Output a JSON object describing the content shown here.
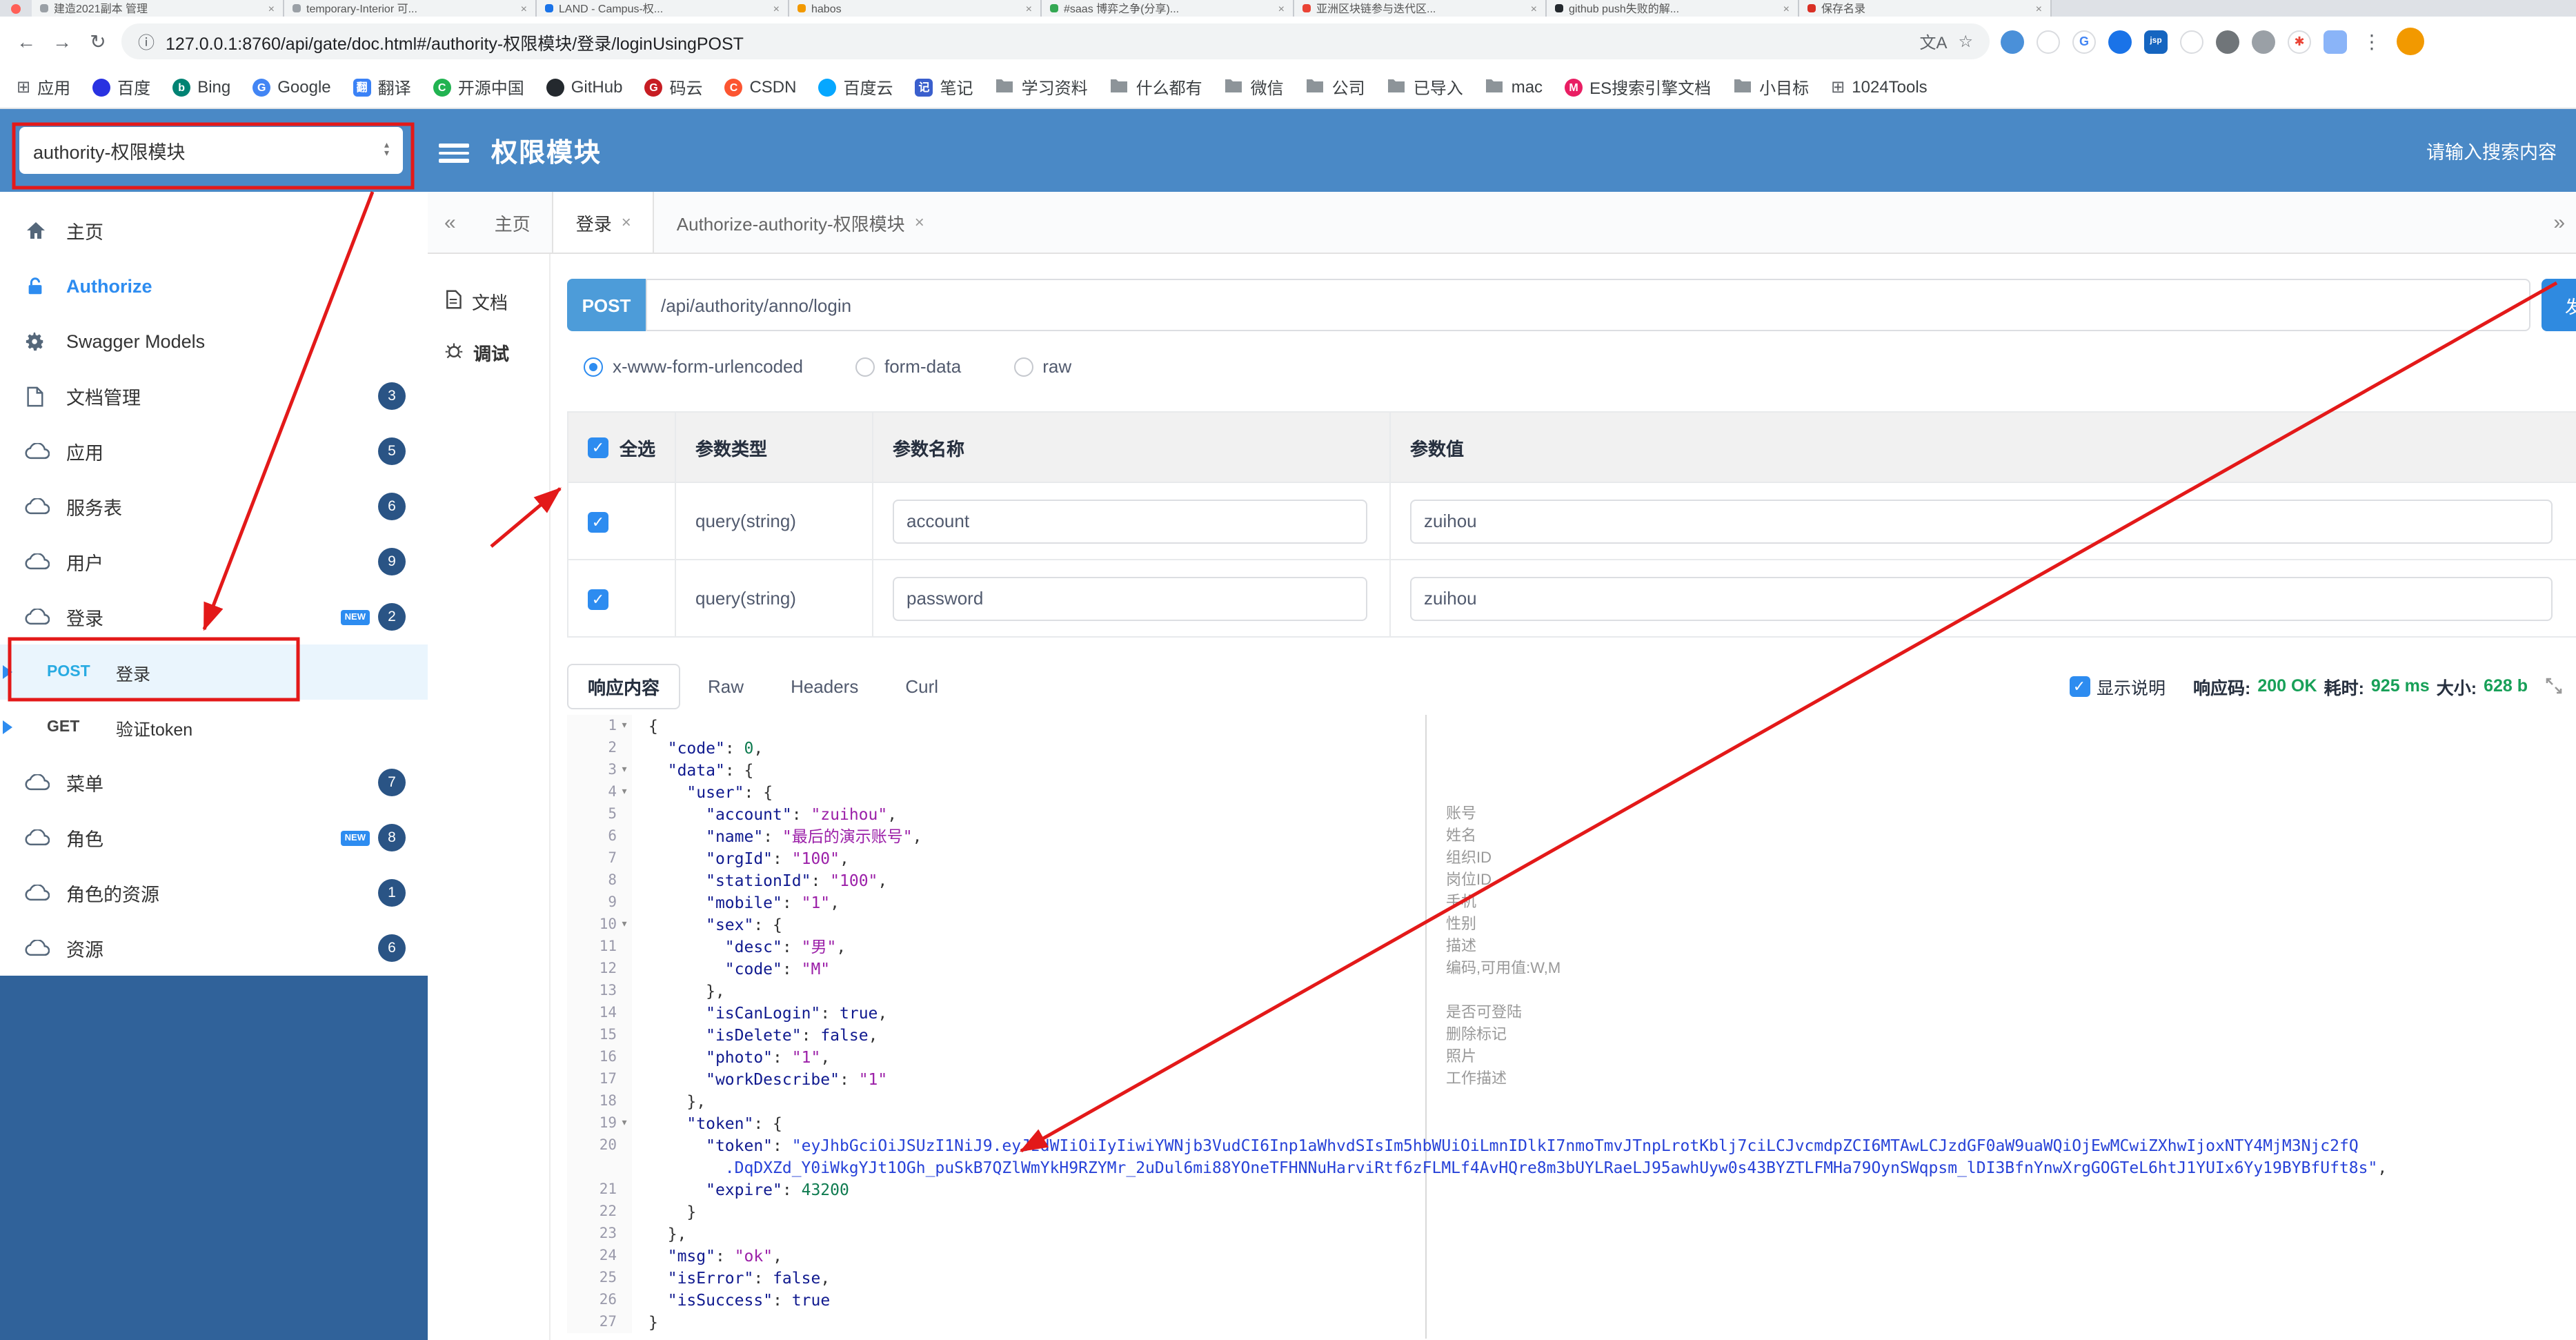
{
  "browser": {
    "window_controls": {
      "close_dot": true
    },
    "tabs": [
      {
        "title": "建造2021副本 管理",
        "color": "#9aa0a6"
      },
      {
        "title": "temporary-Interior 可...",
        "color": "#9aa0a6"
      },
      {
        "title": "LAND - Campus-权...",
        "color": "#1a73e8"
      },
      {
        "title": "habos",
        "color": "#f29900"
      },
      {
        "title": "#saas 博弈之争(分享)...",
        "color": "#34a853"
      },
      {
        "title": "亚洲区块链参与迭代区...",
        "color": "#ea4335"
      },
      {
        "title": "github push失败的解...",
        "color": "#24292e"
      },
      {
        "title": "保存名录",
        "color": "#d93025"
      }
    ],
    "url": "127.0.0.1:8760/api/gate/doc.html#/authority-权限模块/登录/loginUsingPOST",
    "ext_icons": [
      {
        "name": "extension-icon",
        "bg": "#4a90d9"
      },
      {
        "name": "extension-icon",
        "bg": "#ffffff",
        "ring": true
      },
      {
        "name": "google-icon",
        "bg": "#ffffff",
        "ch": "G",
        "fg": "#4285f4",
        "ring": true
      },
      {
        "name": "extension-icon",
        "bg": "#1a73e8"
      },
      {
        "name": "extension-icon",
        "bg": "#1565c0",
        "ch": "jsp",
        "sq": true
      },
      {
        "name": "extension-icon",
        "bg": "#ffffff",
        "ring": true
      },
      {
        "name": "shield-icon",
        "bg": "#707579"
      },
      {
        "name": "extension-icon",
        "bg": "#9aa0a6"
      },
      {
        "name": "extension-icon",
        "bg": "#ffffff",
        "ch": "✱",
        "fg": "#ea4335",
        "ring": true
      },
      {
        "name": "extension-icon",
        "bg": "#8ab4f8",
        "sq": true
      }
    ],
    "bookmarks": [
      {
        "type": "grid",
        "label": "应用"
      },
      {
        "type": "dot",
        "color": "#2932e1",
        "label": "百度"
      },
      {
        "type": "letter",
        "ch": "b",
        "color": "#008373",
        "label": "Bing"
      },
      {
        "type": "letter",
        "ch": "G",
        "color": "#4285f4",
        "label": "Google"
      },
      {
        "type": "sq",
        "ch": "翻",
        "color": "#3b82f6",
        "label": "翻译"
      },
      {
        "type": "letter",
        "ch": "C",
        "color": "#21b351",
        "label": "开源中国"
      },
      {
        "type": "dot",
        "color": "#24292e",
        "label": "GitHub"
      },
      {
        "type": "letter",
        "ch": "G",
        "color": "#c71d23",
        "label": "码云"
      },
      {
        "type": "letter",
        "ch": "C",
        "color": "#fc5531",
        "label": "CSDN"
      },
      {
        "type": "dot",
        "color": "#06a7ff",
        "label": "百度云"
      },
      {
        "type": "sq",
        "ch": "记",
        "color": "#3a5fcd",
        "label": "笔记"
      },
      {
        "type": "folder",
        "label": "学习资料"
      },
      {
        "type": "folder",
        "label": "什么都有"
      },
      {
        "type": "folder",
        "label": "微信"
      },
      {
        "type": "folder",
        "label": "公司"
      },
      {
        "type": "folder",
        "label": "已导入"
      },
      {
        "type": "folder",
        "label": "mac"
      },
      {
        "type": "letter",
        "ch": "M",
        "color": "#e91e63",
        "label": "ES搜索引擎文档"
      },
      {
        "type": "folder",
        "label": "小目标"
      },
      {
        "type": "grid",
        "label": "1024Tools"
      }
    ]
  },
  "header": {
    "module_select": "authority-权限模块",
    "title": "权限模块",
    "search_placeholder": "请输入搜索内容"
  },
  "sidebar": {
    "items": [
      {
        "icon": "home-icon",
        "label": "主页"
      },
      {
        "icon": "unlock-icon",
        "label": "Authorize",
        "highlight": true
      },
      {
        "icon": "gear-icon",
        "label": "Swagger Models"
      },
      {
        "icon": "doc-icon",
        "label": "文档管理",
        "badge": "3"
      },
      {
        "icon": "cloud-icon",
        "label": "应用",
        "badge": "5"
      },
      {
        "icon": "cloud-icon",
        "label": "服务表",
        "badge": "6"
      },
      {
        "icon": "cloud-icon",
        "label": "用户",
        "badge": "9"
      },
      {
        "icon": "cloud-icon",
        "label": "登录",
        "badge": "2",
        "new": true,
        "children": [
          {
            "method": "POST",
            "label": "登录",
            "active": true
          },
          {
            "method": "GET",
            "label": "验证token"
          }
        ]
      },
      {
        "icon": "cloud-icon",
        "label": "菜单",
        "badge": "7"
      },
      {
        "icon": "cloud-icon",
        "label": "角色",
        "badge": "8",
        "new": true
      },
      {
        "icon": "cloud-icon",
        "label": "角色的资源",
        "badge": "1"
      },
      {
        "icon": "cloud-icon",
        "label": "资源",
        "badge": "6"
      }
    ]
  },
  "tabs_nav": {
    "collapse": "«",
    "expand": "»",
    "tabs": [
      {
        "label": "主页"
      },
      {
        "label": "登录",
        "closable": true,
        "active": true
      },
      {
        "label": "Authorize-authority-权限模块",
        "closable": true
      }
    ]
  },
  "docnav": {
    "items": [
      {
        "label": "文档",
        "icon": "doc"
      },
      {
        "label": "调试",
        "icon": "debug",
        "active": true
      }
    ]
  },
  "debug": {
    "method": "POST",
    "url": "/api/authority/anno/login",
    "send_label": "发送",
    "content_types": [
      {
        "label": "x-www-form-urlencoded",
        "selected": true
      },
      {
        "label": "form-data"
      },
      {
        "label": "raw"
      }
    ],
    "table": {
      "headers": [
        "全选",
        "参数类型",
        "参数名称",
        "参数值"
      ],
      "rows": [
        {
          "checked": true,
          "type": "query(string)",
          "name": "account",
          "value": "zuihou"
        },
        {
          "checked": true,
          "type": "query(string)",
          "name": "password",
          "value": "zuihou"
        }
      ]
    }
  },
  "response": {
    "tabs": [
      {
        "label": "响应内容",
        "active": true
      },
      {
        "label": "Raw"
      },
      {
        "label": "Headers"
      },
      {
        "label": "Curl"
      }
    ],
    "show_desc": {
      "label": "显示说明",
      "checked": true
    },
    "metrics": [
      {
        "label": "响应码:",
        "value": "200 OK"
      },
      {
        "label": "耗时:",
        "value": "925 ms"
      },
      {
        "label": "大小:",
        "value": "628 b"
      }
    ]
  },
  "code": {
    "lines": [
      {
        "n": 1,
        "fold": true,
        "seg": [
          [
            "p",
            "{"
          ]
        ]
      },
      {
        "n": 2,
        "seg": [
          [
            "p",
            "  "
          ],
          [
            "k",
            "\"code\""
          ],
          [
            "p",
            ": "
          ],
          [
            "num",
            "0"
          ],
          [
            "p",
            ","
          ]
        ]
      },
      {
        "n": 3,
        "fold": true,
        "seg": [
          [
            "p",
            "  "
          ],
          [
            "k",
            "\"data\""
          ],
          [
            "p",
            ": {"
          ]
        ]
      },
      {
        "n": 4,
        "fold": true,
        "seg": [
          [
            "p",
            "    "
          ],
          [
            "k",
            "\"user\""
          ],
          [
            "p",
            ": {"
          ]
        ]
      },
      {
        "n": 5,
        "desc": "账号",
        "seg": [
          [
            "p",
            "      "
          ],
          [
            "k",
            "\"account\""
          ],
          [
            "p",
            ": "
          ],
          [
            "s",
            "\"zuihou\""
          ],
          [
            "p",
            ","
          ]
        ]
      },
      {
        "n": 6,
        "desc": "姓名",
        "seg": [
          [
            "p",
            "      "
          ],
          [
            "k",
            "\"name\""
          ],
          [
            "p",
            ": "
          ],
          [
            "s",
            "\"最后的演示账号\""
          ],
          [
            "p",
            ","
          ]
        ]
      },
      {
        "n": 7,
        "desc": "组织ID",
        "seg": [
          [
            "p",
            "      "
          ],
          [
            "k",
            "\"orgId\""
          ],
          [
            "p",
            ": "
          ],
          [
            "s",
            "\"100\""
          ],
          [
            "p",
            ","
          ]
        ]
      },
      {
        "n": 8,
        "desc": "岗位ID",
        "seg": [
          [
            "p",
            "      "
          ],
          [
            "k",
            "\"stationId\""
          ],
          [
            "p",
            ": "
          ],
          [
            "s",
            "\"100\""
          ],
          [
            "p",
            ","
          ]
        ]
      },
      {
        "n": 9,
        "desc": "手机",
        "seg": [
          [
            "p",
            "      "
          ],
          [
            "k",
            "\"mobile\""
          ],
          [
            "p",
            ": "
          ],
          [
            "s",
            "\"1\""
          ],
          [
            "p",
            ","
          ]
        ]
      },
      {
        "n": 10,
        "fold": true,
        "desc": "性别",
        "seg": [
          [
            "p",
            "      "
          ],
          [
            "k",
            "\"sex\""
          ],
          [
            "p",
            ": {"
          ]
        ]
      },
      {
        "n": 11,
        "desc": "描述",
        "seg": [
          [
            "p",
            "        "
          ],
          [
            "k",
            "\"desc\""
          ],
          [
            "p",
            ": "
          ],
          [
            "s",
            "\"男\""
          ],
          [
            "p",
            ","
          ]
        ]
      },
      {
        "n": 12,
        "desc": "编码,可用值:W,M",
        "seg": [
          [
            "p",
            "        "
          ],
          [
            "k",
            "\"code\""
          ],
          [
            "p",
            ": "
          ],
          [
            "s",
            "\"M\""
          ]
        ]
      },
      {
        "n": 13,
        "seg": [
          [
            "p",
            "      },"
          ]
        ]
      },
      {
        "n": 14,
        "desc": "是否可登陆",
        "seg": [
          [
            "p",
            "      "
          ],
          [
            "k",
            "\"isCanLogin\""
          ],
          [
            "p",
            ": "
          ],
          [
            "b",
            "true"
          ],
          [
            "p",
            ","
          ]
        ]
      },
      {
        "n": 15,
        "desc": "删除标记",
        "seg": [
          [
            "p",
            "      "
          ],
          [
            "k",
            "\"isDelete\""
          ],
          [
            "p",
            ": "
          ],
          [
            "b",
            "false"
          ],
          [
            "p",
            ","
          ]
        ]
      },
      {
        "n": 16,
        "desc": "照片",
        "seg": [
          [
            "p",
            "      "
          ],
          [
            "k",
            "\"photo\""
          ],
          [
            "p",
            ": "
          ],
          [
            "s",
            "\"1\""
          ],
          [
            "p",
            ","
          ]
        ]
      },
      {
        "n": 17,
        "desc": "工作描述",
        "seg": [
          [
            "p",
            "      "
          ],
          [
            "k",
            "\"workDescribe\""
          ],
          [
            "p",
            ": "
          ],
          [
            "s",
            "\"1\""
          ]
        ]
      },
      {
        "n": 18,
        "seg": [
          [
            "p",
            "    },"
          ]
        ]
      },
      {
        "n": 19,
        "fold": true,
        "seg": [
          [
            "p",
            "    "
          ],
          [
            "k",
            "\"token\""
          ],
          [
            "p",
            ": {"
          ]
        ]
      },
      {
        "n": 20,
        "seg": [
          [
            "p",
            "      "
          ],
          [
            "k",
            "\"token\""
          ],
          [
            "p",
            ": "
          ],
          [
            "ts",
            "\"eyJhbGciOiJSUzI1NiJ9.eyJzdWIiOiIyIiwiYWNjb3VudCI6Inp1aWhvdSIsIm5hbWUiOiLmnIDlkI7nmoTmvJTnpLrotKblj7ciLCJvcmdpZCI6MTAwLCJzdGF0aW9uaWQiOjEwMCwiZXhwIjoxNTY4MjM3Njc2fQ"
          ]
        ],
        "seg2": [
          [
            "p",
            "        "
          ],
          [
            "ts",
            ".DqDXZd_Y0iWkgYJt1OGh_puSkB7QZlWmYkH9RZYMr_2uDul6mi88YOneTFHNNuHarviRtf6zFLMLf4AvHQre8m3bUYLRaeLJ95awhUyw0s43BYZTLFMHa79OynSWqpsm_lDI3BfnYnwXrgGOGTeL6htJ1YUIx6Yy19BYBfUft8s\""
          ],
          [
            "p",
            ","
          ]
        ]
      },
      {
        "n": 21,
        "seg": [
          [
            "p",
            "      "
          ],
          [
            "k",
            "\"expire\""
          ],
          [
            "p",
            ": "
          ],
          [
            "num",
            "43200"
          ]
        ]
      },
      {
        "n": 22,
        "seg": [
          [
            "p",
            "    }"
          ]
        ]
      },
      {
        "n": 23,
        "seg": [
          [
            "p",
            "  },"
          ]
        ]
      },
      {
        "n": 24,
        "seg": [
          [
            "p",
            "  "
          ],
          [
            "k",
            "\"msg\""
          ],
          [
            "p",
            ": "
          ],
          [
            "s",
            "\"ok\""
          ],
          [
            "p",
            ","
          ]
        ]
      },
      {
        "n": 25,
        "seg": [
          [
            "p",
            "  "
          ],
          [
            "k",
            "\"isError\""
          ],
          [
            "p",
            ": "
          ],
          [
            "b",
            "false"
          ],
          [
            "p",
            ","
          ]
        ]
      },
      {
        "n": 26,
        "seg": [
          [
            "p",
            "  "
          ],
          [
            "k",
            "\"isSuccess\""
          ],
          [
            "p",
            ": "
          ],
          [
            "b",
            "true"
          ]
        ]
      },
      {
        "n": 27,
        "seg": [
          [
            "p",
            "}"
          ]
        ]
      }
    ]
  },
  "colors": {
    "header": "#4a89c6",
    "sidebar_fill": "#30629a",
    "primary": "#2d8cf0",
    "method_post_badge": "#4d9cd9",
    "method_post_text": "#29abe2",
    "success": "#18a058",
    "annotation_red": "#e31919"
  }
}
